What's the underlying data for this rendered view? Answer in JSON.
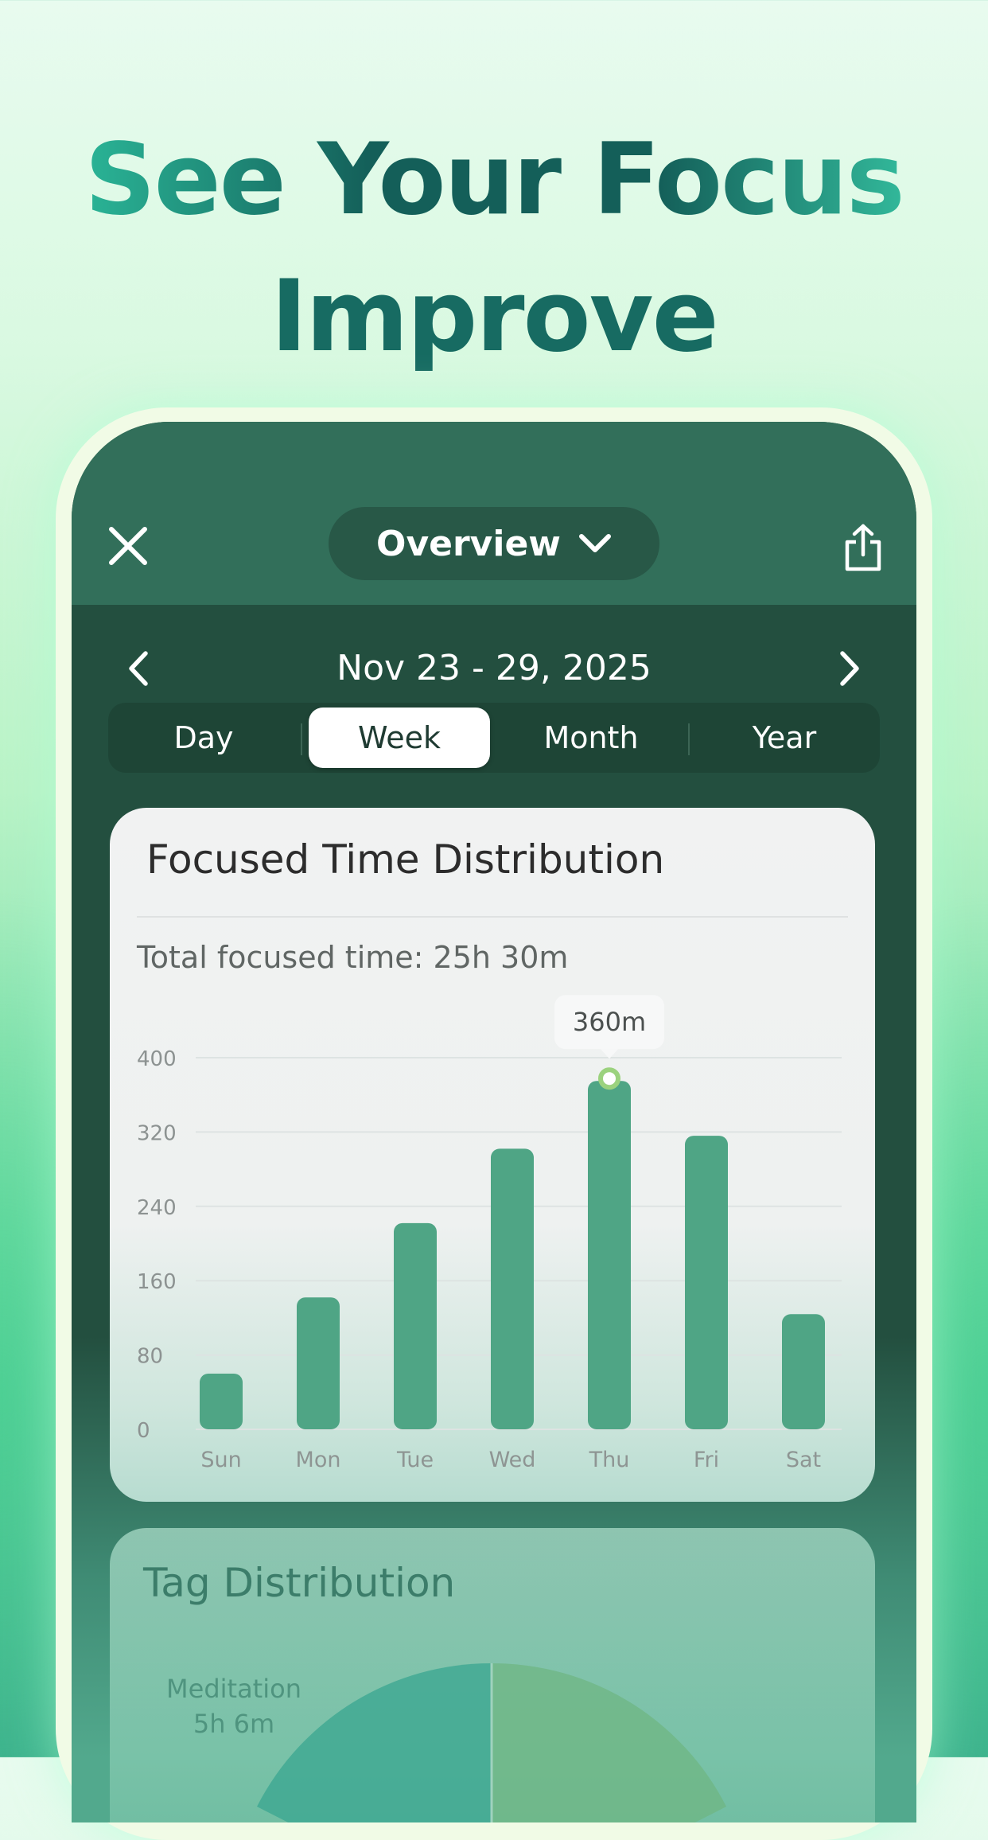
{
  "headline": {
    "line1": "See Your Focus",
    "line2": "Improve"
  },
  "header": {
    "title": "Overview",
    "close_icon": "close-icon",
    "dropdown_icon": "chevron-down-icon",
    "share_icon": "share-icon"
  },
  "date_nav": {
    "label": "Nov 23 - 29, 2025",
    "prev_icon": "chevron-left-icon",
    "next_icon": "chevron-right-icon"
  },
  "period_tabs": [
    {
      "label": "Day",
      "active": false
    },
    {
      "label": "Week",
      "active": true
    },
    {
      "label": "Month",
      "active": false
    },
    {
      "label": "Year",
      "active": false
    }
  ],
  "focused_card": {
    "title": "Focused Time Distribution",
    "total_label": "Total focused time: 25h 30m"
  },
  "chart_data": {
    "type": "bar",
    "categories": [
      "Sun",
      "Mon",
      "Tue",
      "Wed",
      "Thu",
      "Fri",
      "Sat"
    ],
    "values": [
      60,
      142,
      222,
      302,
      375,
      316,
      124
    ],
    "ylim": [
      0,
      400
    ],
    "yticks": [
      0,
      80,
      160,
      240,
      320,
      400
    ],
    "grid": true,
    "highlight_index": 4,
    "tooltip": "360m",
    "bar_color": "#4fa585"
  },
  "tag_card": {
    "title": "Tag Distribution",
    "legend": {
      "name": "Meditation",
      "value": "5h 6m"
    },
    "colors": [
      "#3aa590",
      "#6fb583"
    ]
  },
  "colors": {
    "accent": "#4fa585",
    "topbar": "#326f5a",
    "screen": "#234f3f",
    "headline": "#176b62"
  }
}
